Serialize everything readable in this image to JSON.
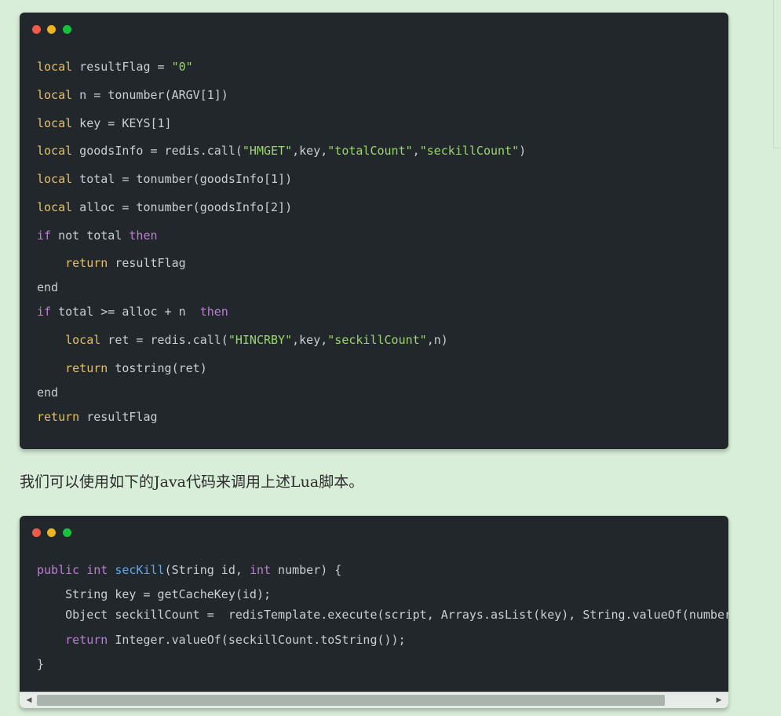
{
  "lua_block": {
    "lines": [
      [
        {
          "t": "local",
          "c": "kw"
        },
        {
          "t": " resultFlag = ",
          "c": "plain"
        },
        {
          "t": "\"0\"",
          "c": "str"
        }
      ],
      [
        {
          "t": "local",
          "c": "kw"
        },
        {
          "t": " n = tonumber(ARGV[1])",
          "c": "plain"
        }
      ],
      [
        {
          "t": "local",
          "c": "kw"
        },
        {
          "t": " key = KEYS[1]",
          "c": "plain"
        }
      ],
      [
        {
          "t": "local",
          "c": "kw"
        },
        {
          "t": " goodsInfo = redis.call(",
          "c": "plain"
        },
        {
          "t": "\"HMGET\"",
          "c": "str"
        },
        {
          "t": ",key,",
          "c": "plain"
        },
        {
          "t": "\"totalCount\"",
          "c": "str"
        },
        {
          "t": ",",
          "c": "plain"
        },
        {
          "t": "\"seckillCount\"",
          "c": "str"
        },
        {
          "t": ")",
          "c": "plain"
        }
      ],
      [
        {
          "t": "local",
          "c": "kw"
        },
        {
          "t": " total = tonumber(goodsInfo[1])",
          "c": "plain"
        }
      ],
      [
        {
          "t": "local",
          "c": "kw"
        },
        {
          "t": " alloc = tonumber(goodsInfo[2])",
          "c": "plain"
        }
      ],
      [
        {
          "t": "if",
          "c": "kw2"
        },
        {
          "t": " not total ",
          "c": "plain"
        },
        {
          "t": "then",
          "c": "kw2"
        }
      ],
      [
        {
          "t": "    ",
          "c": "plain"
        },
        {
          "t": "return",
          "c": "kw"
        },
        {
          "t": " resultFlag",
          "c": "plain"
        }
      ],
      [
        {
          "t": "end",
          "c": "plain"
        }
      ],
      [
        {
          "t": "if",
          "c": "kw2"
        },
        {
          "t": " total >= alloc + n  ",
          "c": "plain"
        },
        {
          "t": "then",
          "c": "kw2"
        }
      ],
      [
        {
          "t": "    ",
          "c": "plain"
        },
        {
          "t": "local",
          "c": "kw"
        },
        {
          "t": " ret = redis.call(",
          "c": "plain"
        },
        {
          "t": "\"HINCRBY\"",
          "c": "str"
        },
        {
          "t": ",key,",
          "c": "plain"
        },
        {
          "t": "\"seckillCount\"",
          "c": "str"
        },
        {
          "t": ",n)",
          "c": "plain"
        }
      ],
      [
        {
          "t": "    ",
          "c": "plain"
        },
        {
          "t": "return",
          "c": "kw"
        },
        {
          "t": " tostring(ret)",
          "c": "plain"
        }
      ],
      [
        {
          "t": "end",
          "c": "plain"
        }
      ],
      [
        {
          "t": "return",
          "c": "kw"
        },
        {
          "t": " resultFlag",
          "c": "plain"
        }
      ]
    ]
  },
  "prose": {
    "text": "我们可以使用如下的Java代码来调用上述Lua脚本。"
  },
  "java_block": {
    "lines": [
      [
        {
          "t": "public",
          "c": "kw2"
        },
        {
          "t": " ",
          "c": "plain"
        },
        {
          "t": "int",
          "c": "kw2"
        },
        {
          "t": " ",
          "c": "plain"
        },
        {
          "t": "secKill",
          "c": "fn"
        },
        {
          "t": "(String id, ",
          "c": "plain"
        },
        {
          "t": "int",
          "c": "kw2"
        },
        {
          "t": " number) {",
          "c": "plain"
        }
      ],
      [
        {
          "t": "    String key = getCacheKey(id);",
          "c": "plain"
        }
      ],
      [
        {
          "t": "    Object seckillCount =  redisTemplate.execute(script, Arrays.asList(key), String.valueOf(number",
          "c": "plain"
        }
      ],
      [
        {
          "t": "    ",
          "c": "plain"
        },
        {
          "t": "return",
          "c": "kw2"
        },
        {
          "t": " Integer.valueOf(seckillCount.toString());",
          "c": "plain"
        }
      ],
      [
        {
          "t": "}",
          "c": "plain"
        }
      ]
    ]
  },
  "scrollbar": {
    "left_arrow": "◀",
    "right_arrow": "▶"
  }
}
